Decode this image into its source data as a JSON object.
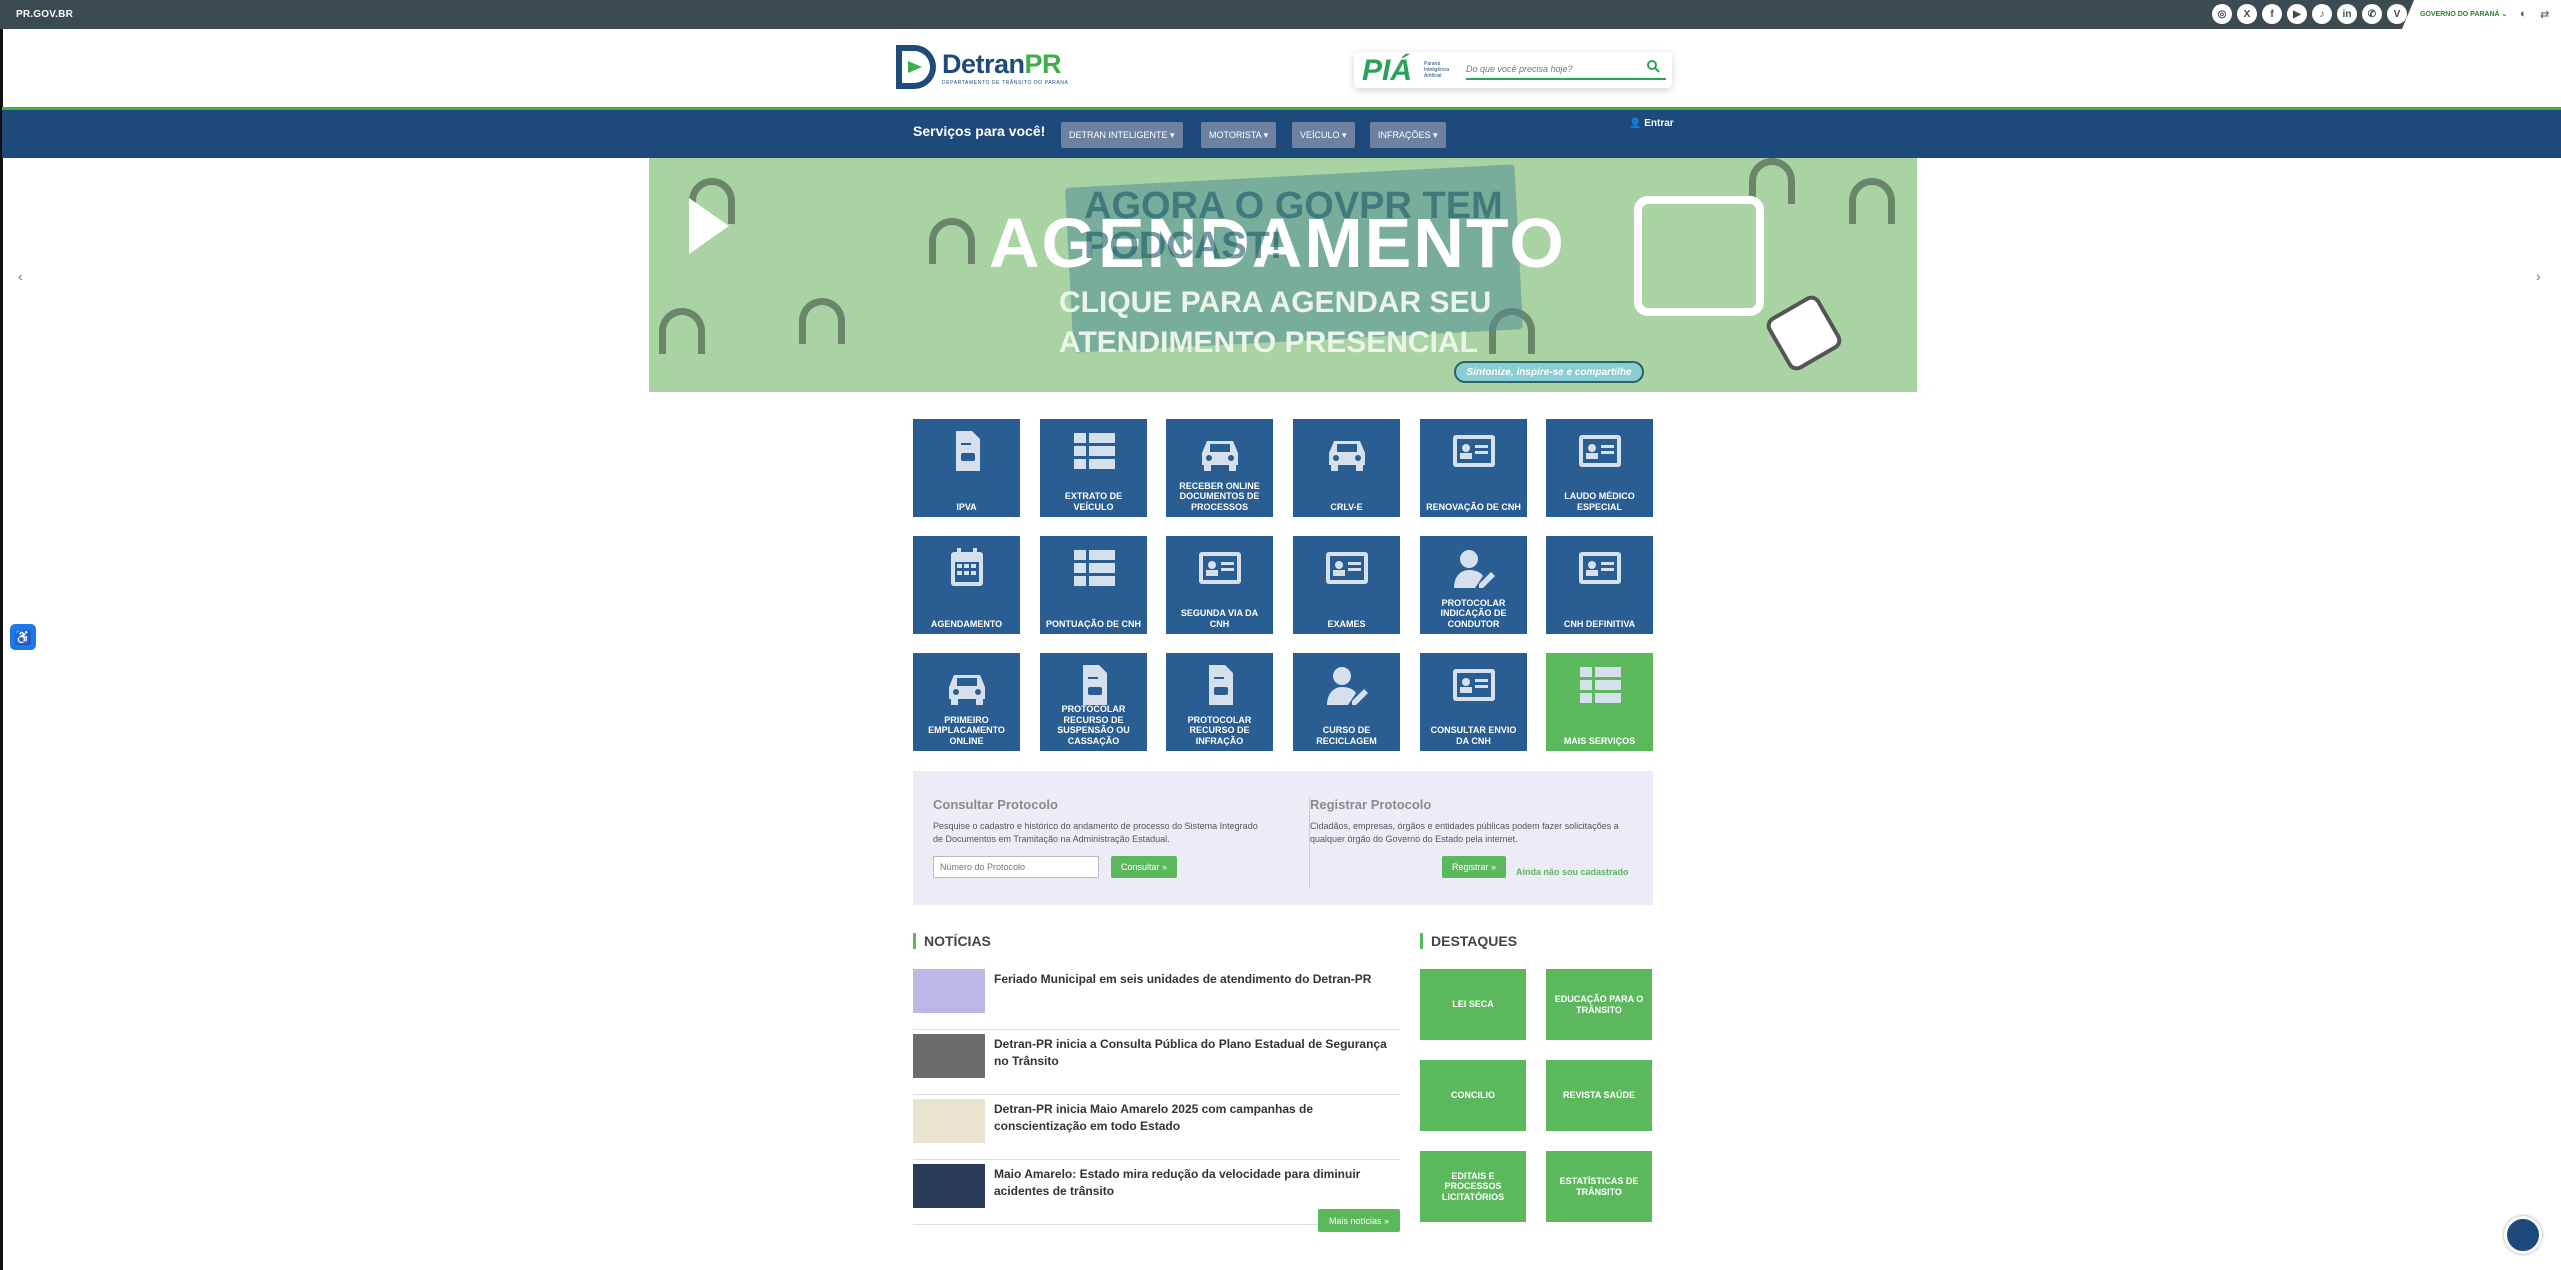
{
  "topbar": {
    "site": "PR.GOV.BR",
    "gov_label": "GOVERNO DO PARANÁ ⌄",
    "social_icons": [
      "instagram-icon",
      "x-icon",
      "facebook-icon",
      "youtube-icon",
      "tiktok-icon",
      "linkedin-icon",
      "whatsapp-icon",
      "v-icon"
    ]
  },
  "header": {
    "logo_main": "Detran",
    "logo_accent": "PR",
    "logo_sub": "DEPARTAMENTO DE TRÂNSITO DO PARANÁ",
    "pia_title": "PIÁ",
    "pia_sub": "Paraná Inteligência Artificial",
    "search_placeholder": "Do que você precisa hoje?"
  },
  "nav": {
    "title": "Serviços para você!",
    "menus": [
      "DETRAN INTELIGENTE ▾",
      "MOTORISTA ▾",
      "VEÍCULO ▾",
      "INFRAÇÕES ▾"
    ],
    "login": "Entrar"
  },
  "banner": {
    "headline": "AGENDAMENTO",
    "overlay": "AGORA O GOVPR TEM PODCAST!",
    "sub1": "CLIQUE PARA AGENDAR SEU",
    "sub2": "ATENDIMENTO PRESENCIAL",
    "tagline": "Sintonize, inspire-se e compartilhe"
  },
  "services": [
    {
      "label": "IPVA",
      "icon": "document-car-icon"
    },
    {
      "label": "Extrato de Veículo",
      "icon": "list-icon"
    },
    {
      "label": "Receber Online Documentos de Processos",
      "icon": "car-icon"
    },
    {
      "label": "CRLV-e",
      "icon": "car-icon"
    },
    {
      "label": "Renovação de CNH",
      "icon": "id-card-icon"
    },
    {
      "label": "Laudo Médico Especial",
      "icon": "id-card-icon"
    },
    {
      "label": "Agendamento",
      "icon": "calendar-icon"
    },
    {
      "label": "Pontuação de CNH",
      "icon": "list-icon"
    },
    {
      "label": "Segunda via da CNH",
      "icon": "id-card-icon"
    },
    {
      "label": "Exames",
      "icon": "id-card-icon"
    },
    {
      "label": "Protocolar Indicação de Condutor",
      "icon": "user-edit-icon"
    },
    {
      "label": "CNH Definitiva",
      "icon": "id-card-icon"
    },
    {
      "label": "Primeiro Emplacamento Online",
      "icon": "car-icon"
    },
    {
      "label": "Protocolar Recurso de Suspensão ou Cassação",
      "icon": "document-car-icon"
    },
    {
      "label": "Protocolar Recurso de Infração",
      "icon": "document-car-icon"
    },
    {
      "label": "Curso de Reciclagem",
      "icon": "user-edit-icon"
    },
    {
      "label": "Consultar Envio da CNH",
      "icon": "id-card-icon"
    },
    {
      "label": "Mais Serviços",
      "icon": "list-icon"
    }
  ],
  "protocol": {
    "consult_title": "Consultar Protocolo",
    "consult_text": "Pesquise o cadastro e histórico do andamento de processo do Sistema Integrado de Documentos em Tramitação na Administração Estadual.",
    "consult_placeholder": "Número do Protocolo",
    "consult_button": "Consultar »",
    "register_title": "Registrar Protocolo",
    "register_text": "Cidadãos, empresas, órgãos e entidades públicas podem fazer solicitações a qualquer órgão do Governo do Estado pela internet.",
    "register_button": "Registrar »",
    "register_link": "Ainda não sou cadastrado"
  },
  "news": {
    "title": "NOTÍCIAS",
    "items": [
      {
        "title": "Feriado Municipal em seis unidades de atendimento do Detran-PR"
      },
      {
        "title": "Detran-PR inicia a Consulta Pública do Plano Estadual de Segurança no Trânsito"
      },
      {
        "title": "Detran-PR inicia Maio Amarelo 2025 com campanhas de conscientização em todo Estado"
      },
      {
        "title": "Maio Amarelo: Estado mira redução da velocidade para diminuir acidentes de trânsito"
      }
    ],
    "more": "Mais notícias »"
  },
  "highlights": {
    "title": "DESTAQUES",
    "items": [
      "Lei Seca",
      "Educação para o Trânsito",
      "Concilio",
      "Revista Saúde",
      "Editais e Processos Licitatórios",
      "Estatísticas de Trânsito"
    ]
  }
}
